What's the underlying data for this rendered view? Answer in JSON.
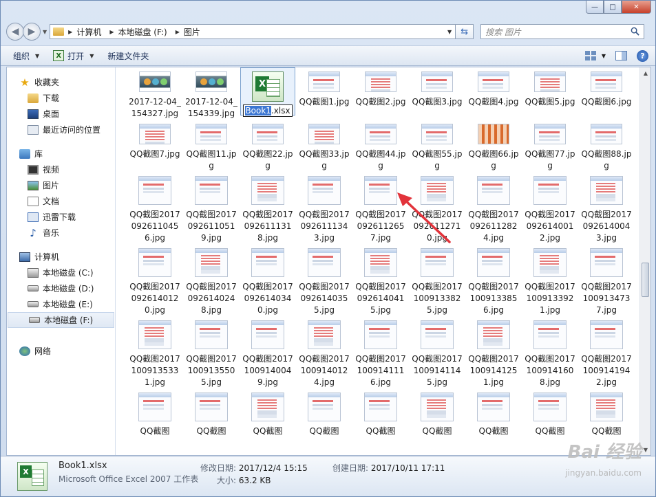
{
  "window": {
    "caption": {
      "minimize": "—",
      "maximize": "□",
      "close": "✕"
    }
  },
  "address": {
    "crumbs": [
      "计算机",
      "本地磁盘 (F:)",
      "图片"
    ]
  },
  "search": {
    "placeholder": "搜索 图片"
  },
  "toolbar": {
    "organize": "组织",
    "open": "打开",
    "new_folder": "新建文件夹"
  },
  "sidebar": {
    "favorites": {
      "label": "收藏夹",
      "items": [
        "下载",
        "桌面",
        "最近访问的位置"
      ]
    },
    "libraries": {
      "label": "库",
      "items": [
        "视频",
        "图片",
        "文档",
        "迅雷下载",
        "音乐"
      ]
    },
    "computer": {
      "label": "计算机",
      "items": [
        "本地磁盘 (C:)",
        "本地磁盘 (D:)",
        "本地磁盘 (E:)",
        "本地磁盘 (F:)"
      ],
      "selected": "本地磁盘 (F:)"
    },
    "network": {
      "label": "网络"
    }
  },
  "files": {
    "rename": {
      "highlight": "Book1",
      "rest": ".xlsx"
    },
    "rows": [
      [
        "2017-12-04_154327.jpg",
        "2017-12-04_154339.jpg",
        "Book1.xlsx",
        "QQ截图1.jpg",
        "QQ截图2.jpg",
        "QQ截图3.jpg",
        "QQ截图4.jpg",
        "QQ截图5.jpg",
        "QQ截图6.jpg"
      ],
      [
        "QQ截图7.jpg",
        "QQ截图11.jpg",
        "QQ截图22.jpg",
        "QQ截图33.jpg",
        "QQ截图44.jpg",
        "QQ截图55.jpg",
        "QQ截图66.jpg",
        "QQ截图77.jpg",
        "QQ截图88.jpg"
      ],
      [
        "QQ截图20170926110456.jpg",
        "QQ截图20170926110519.jpg",
        "QQ截图20170926111318.jpg",
        "QQ截图20170926111343.jpg",
        "QQ截图20170926112657.jpg",
        "QQ截图20170926112710.jpg",
        "QQ截图20170926112824.jpg",
        "QQ截图20170926140012.jpg",
        "QQ截图20170926140043.jpg"
      ],
      [
        "QQ截图20170926140120.jpg",
        "QQ截图20170926140248.jpg",
        "QQ截图20170926140340.jpg",
        "QQ截图20170926140355.jpg",
        "QQ截图20170926140415.jpg",
        "QQ截图20171009133825.jpg",
        "QQ截图20171009133856.jpg",
        "QQ截图20171009133921.jpg",
        "QQ截图20171009134737.jpg"
      ],
      [
        "QQ截图20171009135331.jpg",
        "QQ截图20171009135505.jpg",
        "QQ截图20171009140049.jpg",
        "QQ截图20171009140124.jpg",
        "QQ截图20171009141116.jpg",
        "QQ截图20171009141145.jpg",
        "QQ截图20171009141251.jpg",
        "QQ截图20171009141608.jpg",
        "QQ截图20171009141942.jpg"
      ],
      [
        "QQ截图",
        "QQ截图",
        "QQ截图",
        "QQ截图",
        "QQ截图",
        "QQ截图",
        "QQ截图",
        "QQ截图",
        "QQ截图"
      ]
    ]
  },
  "details": {
    "name": "Book1.xlsx",
    "type": "Microsoft Office Excel 2007 工作表",
    "modified_label": "修改日期:",
    "modified_value": "2017/12/4 15:15",
    "size_label": "大小:",
    "size_value": "63.2 KB",
    "created_label": "创建日期:",
    "created_value": "2017/10/11 17:11"
  },
  "watermark": {
    "brand": "Bai 经验",
    "url": "jingyan.baidu.com"
  },
  "colors": {
    "accent": "#3b76d2",
    "arrow": "#e2333b"
  }
}
